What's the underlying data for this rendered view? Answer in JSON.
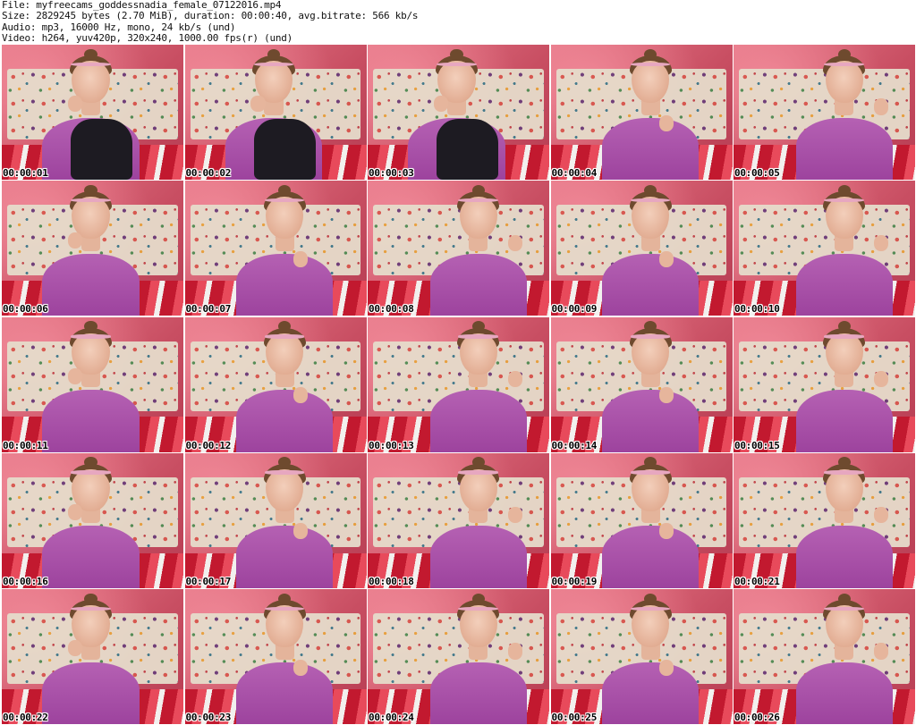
{
  "header": {
    "file_line": "File: myfreecams_goddessnadia_female_07122016.mp4",
    "size_line": "Size: 2829245 bytes (2.70 MiB), duration: 00:00:40, avg.bitrate: 566 kb/s",
    "audio_line": "Audio: mp3, 16000 Hz, mono, 24 kb/s (und)",
    "video_line": "Video: h264, yuv420p, 320x240, 1000.00 fps(r) (und)"
  },
  "thumbnails": [
    {
      "timestamp": "00:00:01",
      "pose": "a",
      "legs": true
    },
    {
      "timestamp": "00:00:02",
      "pose": "a",
      "legs": true
    },
    {
      "timestamp": "00:00:03",
      "pose": "a",
      "legs": true
    },
    {
      "timestamp": "00:00:04",
      "pose": "b",
      "legs": false
    },
    {
      "timestamp": "00:00:05",
      "pose": "c",
      "legs": false
    },
    {
      "timestamp": "00:00:06",
      "pose": "a",
      "legs": false
    },
    {
      "timestamp": "00:00:07",
      "pose": "b",
      "legs": false
    },
    {
      "timestamp": "00:00:08",
      "pose": "c",
      "legs": false
    },
    {
      "timestamp": "00:00:09",
      "pose": "b",
      "legs": false
    },
    {
      "timestamp": "00:00:10",
      "pose": "c",
      "legs": false
    },
    {
      "timestamp": "00:00:11",
      "pose": "a",
      "legs": false
    },
    {
      "timestamp": "00:00:12",
      "pose": "b",
      "legs": false
    },
    {
      "timestamp": "00:00:13",
      "pose": "c",
      "legs": false
    },
    {
      "timestamp": "00:00:14",
      "pose": "b",
      "legs": false
    },
    {
      "timestamp": "00:00:15",
      "pose": "c",
      "legs": false
    },
    {
      "timestamp": "00:00:16",
      "pose": "a",
      "legs": false
    },
    {
      "timestamp": "00:00:17",
      "pose": "b",
      "legs": false
    },
    {
      "timestamp": "00:00:18",
      "pose": "c",
      "legs": false
    },
    {
      "timestamp": "00:00:19",
      "pose": "b",
      "legs": false
    },
    {
      "timestamp": "00:00:21",
      "pose": "c",
      "legs": false
    },
    {
      "timestamp": "00:00:22",
      "pose": "a",
      "legs": false
    },
    {
      "timestamp": "00:00:23",
      "pose": "b",
      "legs": false
    },
    {
      "timestamp": "00:00:24",
      "pose": "c",
      "legs": false
    },
    {
      "timestamp": "00:00:25",
      "pose": "b",
      "legs": false
    },
    {
      "timestamp": "00:00:26",
      "pose": "c",
      "legs": false
    }
  ]
}
